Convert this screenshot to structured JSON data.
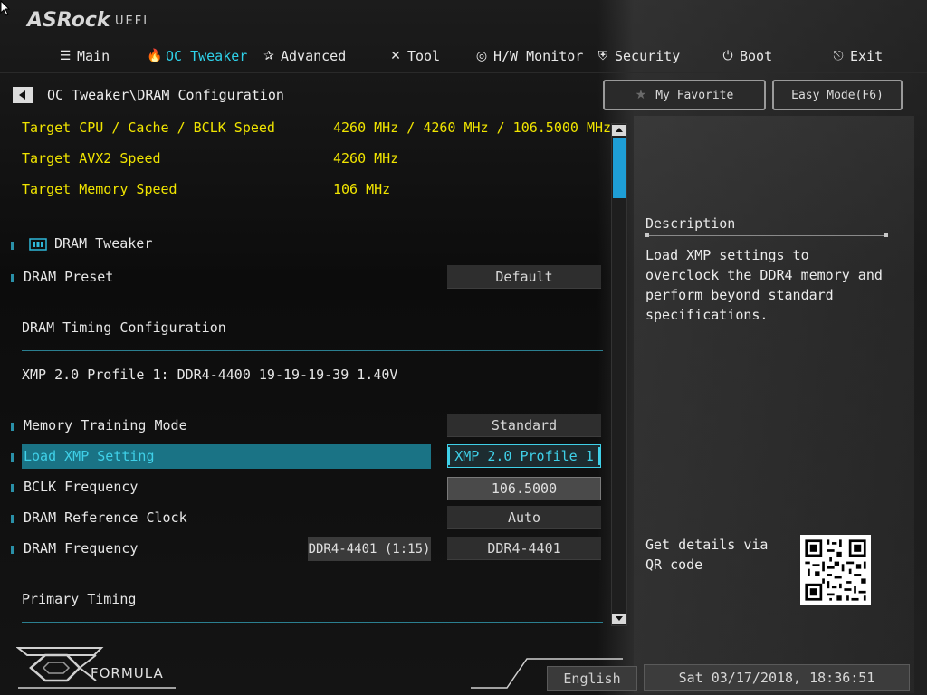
{
  "brand": {
    "logo": "ASRock",
    "suffix": "UEFI"
  },
  "tabs": [
    {
      "label": "Main",
      "icon": "list-icon"
    },
    {
      "label": "OC Tweaker",
      "icon": "flame-icon",
      "active": true
    },
    {
      "label": "Advanced",
      "icon": "star-icon"
    },
    {
      "label": "Tool",
      "icon": "tools-icon"
    },
    {
      "label": "H/W Monitor",
      "icon": "monitor-icon"
    },
    {
      "label": "Security",
      "icon": "shield-icon"
    },
    {
      "label": "Boot",
      "icon": "power-icon"
    },
    {
      "label": "Exit",
      "icon": "exit-icon"
    }
  ],
  "breadcrumb": "OC Tweaker\\DRAM Configuration",
  "buttons": {
    "favorite": "My Favorite",
    "easy_mode": "Easy Mode(F6)"
  },
  "targets": [
    {
      "label": "Target CPU / Cache / BCLK Speed",
      "value": "4260 MHz / 4260 MHz / 106.5000 MHz"
    },
    {
      "label": "Target AVX2 Speed",
      "value": "4260 MHz"
    },
    {
      "label": "Target Memory Speed",
      "value": "106 MHz"
    }
  ],
  "sections": {
    "dram_tweaker": "DRAM Tweaker",
    "dram_timing": "DRAM Timing Configuration",
    "xmp_info": "XMP 2.0 Profile 1: DDR4-4400 19-19-19-39 1.40V",
    "primary_timing": "Primary Timing"
  },
  "settings": {
    "dram_preset": {
      "label": "DRAM Preset",
      "value": "Default"
    },
    "memory_training": {
      "label": "Memory Training Mode",
      "value": "Standard"
    },
    "load_xmp": {
      "label": "Load XMP Setting",
      "value": "XMP 2.0 Profile 1"
    },
    "bclk": {
      "label": "BCLK Frequency",
      "value": "106.5000"
    },
    "dram_ref_clock": {
      "label": "DRAM Reference Clock",
      "value": "Auto"
    },
    "dram_freq": {
      "label": "DRAM Frequency",
      "hint": "DDR4-4401 (1:15)",
      "value": "DDR4-4401"
    }
  },
  "description": {
    "title": "Description",
    "text": "Load XMP settings to overclock the DDR4 memory and perform beyond standard specifications."
  },
  "qr": {
    "text": "Get details via QR code"
  },
  "footer": {
    "formula": "FORMULA",
    "language": "English",
    "datetime": "Sat 03/17/2018, 18:36:51"
  },
  "colors": {
    "accent": "#2fd2ea",
    "highlight": "#1a7385",
    "target_text": "#f0e400",
    "scroll_thumb": "#1e9ed6"
  }
}
